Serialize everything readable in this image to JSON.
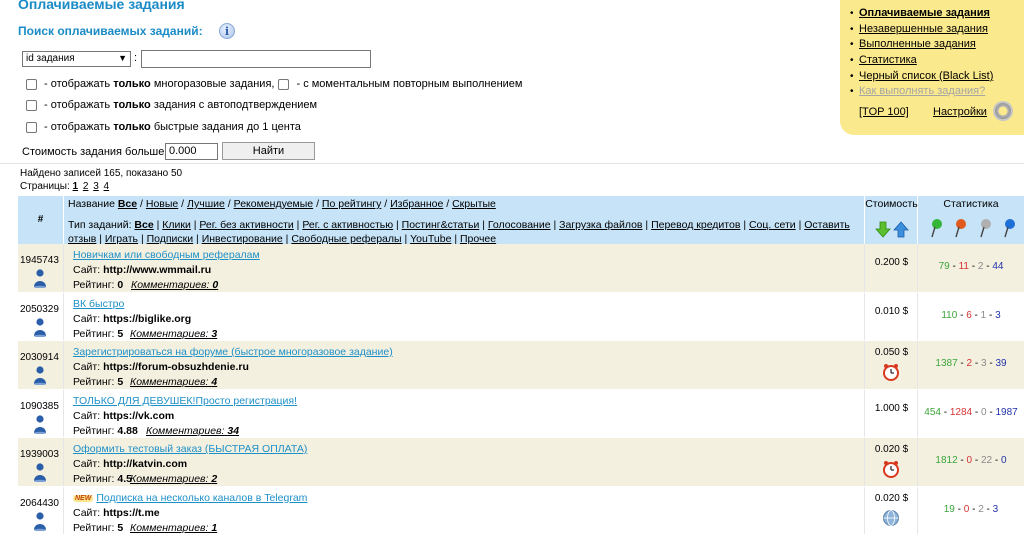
{
  "header": {
    "title": "Оплачиваемые задания",
    "search_title": "Поиск оплачиваемых заданий:",
    "help_icon": "i"
  },
  "search": {
    "select_value": "id задания",
    "colon": ":",
    "input_value": "",
    "filters": [
      {
        "prefix": "- отображать ",
        "bold": "только",
        "suffix": " многоразовые задания,",
        "extra": "- с моментальным повторным выполнением"
      },
      {
        "prefix": "- отображать ",
        "bold": "только",
        "suffix": " задания с автоподтверждением"
      },
      {
        "prefix": "- отображать ",
        "bold": "только",
        "suffix": " быстрые задания до 1 цента"
      }
    ],
    "cost_label": "Стоимость задания больше",
    "cost_value": "0.000",
    "find_button": "Найти"
  },
  "results": {
    "found_text": "Найдено записей 165, показано 50",
    "pages_label": "Страницы:",
    "pages": [
      "1",
      "2",
      "3",
      "4"
    ]
  },
  "right_panel": {
    "items": [
      {
        "label": "Оплачиваемые задания",
        "style": "bold"
      },
      {
        "label": "Незавершенные задания",
        "style": "normal"
      },
      {
        "label": "Выполненные задания",
        "style": "normal"
      },
      {
        "label": "Статистика",
        "style": "normal"
      },
      {
        "label": "Черный список (Black List)",
        "style": "normal"
      },
      {
        "label": "Как выполнять задания?",
        "style": "gray"
      }
    ],
    "top100": "[TOP 100]",
    "settings": "Настройки",
    "icons": {
      "settings": "gear-icon"
    }
  },
  "table": {
    "header": {
      "id": "#",
      "sort_label": "Название",
      "sort_links": [
        "Все",
        "Новые",
        "Лучшие",
        "Рекомендуемые",
        "По рейтингу",
        "Избранное",
        "Скрытые"
      ],
      "type_label": "Тип заданий:",
      "type_links": [
        "Все",
        "Клики",
        "Рег. без активности",
        "Рег. с активностью",
        "Постинг&статьи",
        "Голосование",
        "Загрузка файлов",
        "Перевод кредитов",
        "Соц. сети",
        "Оставить отзыв",
        "Играть",
        "Подписки",
        "Инвестирование",
        "Свободные рефералы",
        "YouTube",
        "Прочее"
      ],
      "cost": "Стоимость",
      "stats": "Статистика",
      "pin_colors": [
        "#35b535",
        "#e05a1e",
        "#b0b0b0",
        "#1e6fd6"
      ]
    },
    "rows": [
      {
        "id": "1945743",
        "title": "Новичкам или свободным рефералам",
        "site_label": "Сайт:",
        "site": "http://www.wmmail.ru",
        "rating_label": "Рейтинг:",
        "rating": "0",
        "comments_label": "Комментариев:",
        "comments": "0",
        "price": "0.200 $",
        "badge": "",
        "icon": "",
        "stats": [
          "79",
          "11",
          "2",
          "44"
        ]
      },
      {
        "id": "2050329",
        "title": "ВК быстро",
        "site_label": "Сайт:",
        "site": "https://biglike.org",
        "rating_label": "Рейтинг:",
        "rating": "5",
        "comments_label": "Комментариев:",
        "comments": "3",
        "price": "0.010 $",
        "badge": "",
        "icon": "",
        "stats": [
          "110",
          "6",
          "1",
          "3"
        ]
      },
      {
        "id": "2030914",
        "title": "Зарегистрироваться на форуме (быстрое многоразовое задание)",
        "site_label": "Сайт:",
        "site": "https://forum-obsuzhdenie.ru",
        "rating_label": "Рейтинг:",
        "rating": "5",
        "comments_label": "Комментариев:",
        "comments": "4",
        "price": "0.050 $",
        "badge": "",
        "icon": "clock-icon",
        "stats": [
          "1387",
          "2",
          "3",
          "39"
        ]
      },
      {
        "id": "1090385",
        "title": "ТОЛЬКО ДЛЯ ДЕВУШЕК!Просто регистрация!",
        "site_label": "Сайт:",
        "site": "https://vk.com",
        "rating_label": "Рейтинг:",
        "rating": "4.88",
        "comments_label": "Комментариев:",
        "comments": "34",
        "price": "1.000 $",
        "badge": "",
        "icon": "",
        "stats": [
          "454",
          "1284",
          "0",
          "1987"
        ]
      },
      {
        "id": "1939003",
        "title": "Оформить тестовый заказ (БЫСТРАЯ ОПЛАТА)",
        "site_label": "Сайт:",
        "site": "http://katvin.com",
        "rating_label": "Рейтинг:",
        "rating": "4.5",
        "comments_label": "Комментариев:",
        "comments": "2",
        "price": "0.020 $",
        "badge": "",
        "icon": "clock-icon",
        "stats": [
          "1812",
          "0",
          "22",
          "0"
        ]
      },
      {
        "id": "2064430",
        "title": "Подписка на несколько каналов в Telegram",
        "site_label": "Сайт:",
        "site": "https://t.me",
        "rating_label": "Рейтинг:",
        "rating": "5",
        "comments_label": "Комментариев:",
        "comments": "1",
        "price": "0.020 $",
        "badge": "NEW",
        "icon": "globe-icon",
        "stats": [
          "19",
          "0",
          "2",
          "3"
        ]
      }
    ]
  },
  "colors": {
    "title_blue": "#1b8bc6",
    "header_bg": "#c6e3f7",
    "row_alt_bg": "#f4f0e0",
    "panel_bg": "#fbe98d",
    "stat_green": "#3aa53a",
    "stat_red": "#d63232",
    "stat_gray": "#8a8a8a",
    "stat_blue": "#2233aa"
  }
}
